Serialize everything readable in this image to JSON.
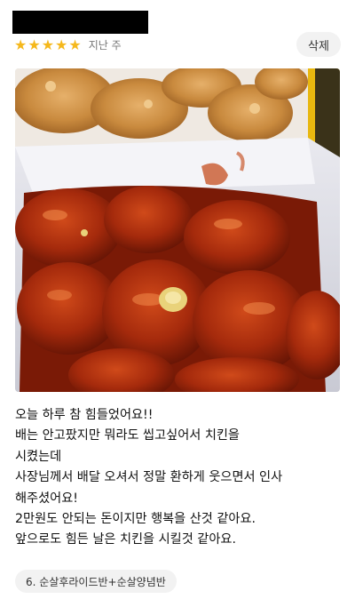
{
  "review": {
    "rating_stars": [
      "★",
      "★",
      "★",
      "★",
      "★"
    ],
    "rating_color": "#f5b81c",
    "date": "지난 주",
    "delete_label": "삭제",
    "text": "오늘 하루 참 힘들었어요!!\n배는 안고팠지만 뭐라도 씹고싶어서 치킨을\n시켰는데\n사장님께서 배달 오셔서 정말 환하게 웃으면서 인사\n해주셨어요!\n2만원도 안되는 돈이지만 행복을 산것 같아요.\n앞으로도 힘든 날은 치킨을 시킬것 같아요.",
    "menu_chip": "6. 순살후라이드반+순살양념반"
  }
}
